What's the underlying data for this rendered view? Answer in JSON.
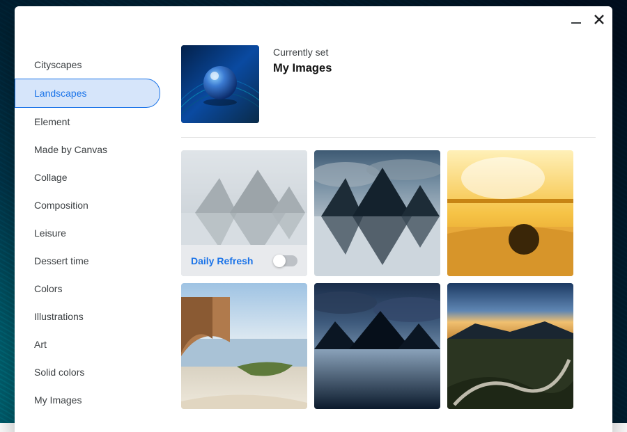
{
  "sidebar": {
    "active_index": 1,
    "items": [
      {
        "label": "Cityscapes"
      },
      {
        "label": "Landscapes"
      },
      {
        "label": "Element"
      },
      {
        "label": "Made by Canvas"
      },
      {
        "label": "Collage"
      },
      {
        "label": "Composition"
      },
      {
        "label": "Leisure"
      },
      {
        "label": "Dessert time"
      },
      {
        "label": "Colors"
      },
      {
        "label": "Illustrations"
      },
      {
        "label": "Art"
      },
      {
        "label": "Solid colors"
      },
      {
        "label": "My Images"
      }
    ]
  },
  "current": {
    "eyebrow": "Currently set",
    "title": "My Images",
    "thumb_icon": "water-drop"
  },
  "daily_refresh": {
    "label": "Daily Refresh",
    "on": false
  },
  "tiles": [
    {
      "kind": "refresh",
      "icon": "mountain-mirror"
    },
    {
      "kind": "wallpaper",
      "icon": "mountain-overcast"
    },
    {
      "kind": "wallpaper",
      "icon": "golden-beach"
    },
    {
      "kind": "wallpaper",
      "icon": "rocky-shore"
    },
    {
      "kind": "wallpaper",
      "icon": "dark-lake"
    },
    {
      "kind": "wallpaper",
      "icon": "winding-road"
    }
  ],
  "colors": {
    "accent": "#1a73e8"
  }
}
